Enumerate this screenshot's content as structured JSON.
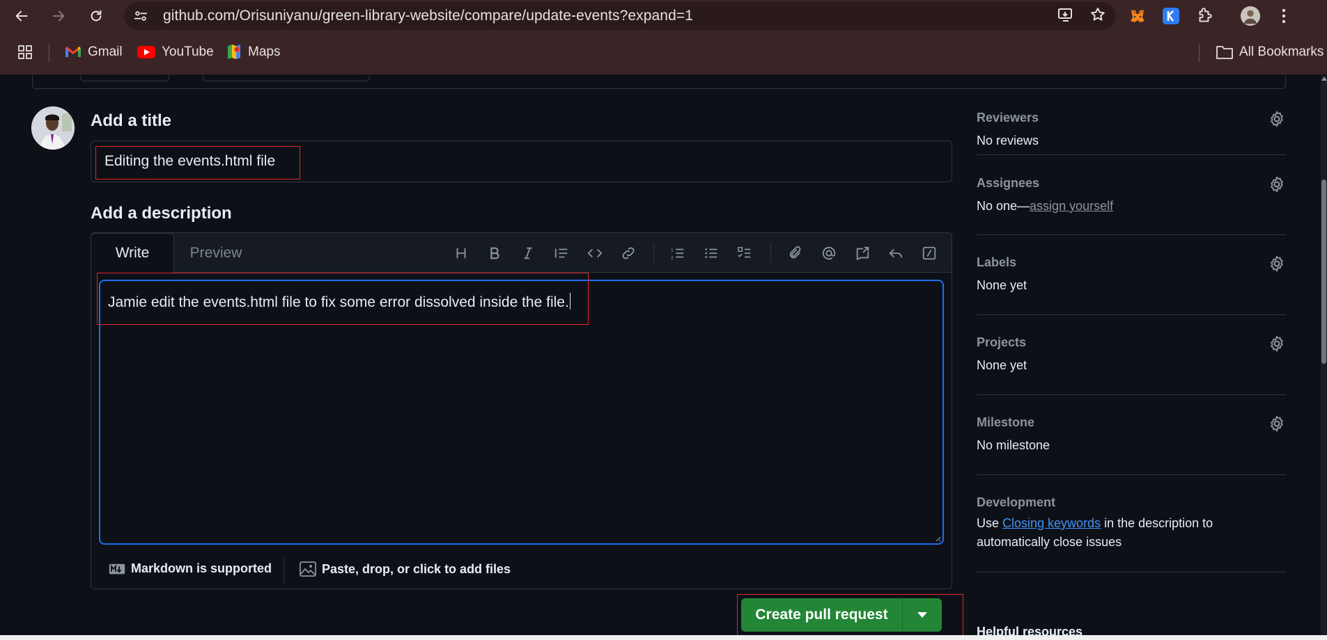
{
  "browser": {
    "url": "github.com/Orisuniyanu/green-library-website/compare/update-events?expand=1",
    "bookmarks": [
      {
        "label": "Gmail",
        "icon": "gmail-icon"
      },
      {
        "label": "YouTube",
        "icon": "youtube-icon"
      },
      {
        "label": "Maps",
        "icon": "maps-icon"
      }
    ],
    "all_bookmarks_label": "All Bookmarks"
  },
  "pr_form": {
    "title_heading": "Add a title",
    "title_value": "Editing the events.html file",
    "description_heading": "Add a description",
    "tabs": [
      "Write",
      "Preview"
    ],
    "description_value": "Jamie edit the events.html file to fix some error dissolved inside the file.",
    "markdown_note": "Markdown is supported",
    "attach_note": "Paste, drop, or click to add files",
    "submit_label": "Create pull request"
  },
  "sidebar": {
    "reviewers": {
      "heading": "Reviewers",
      "value": "No reviews"
    },
    "assignees": {
      "heading": "Assignees",
      "value_prefix": "No one—",
      "value_link": "assign yourself"
    },
    "labels": {
      "heading": "Labels",
      "value": "None yet"
    },
    "projects": {
      "heading": "Projects",
      "value": "None yet"
    },
    "milestone": {
      "heading": "Milestone",
      "value": "No milestone"
    },
    "development": {
      "heading": "Development",
      "text_prefix": "Use ",
      "link": "Closing keywords",
      "text_suffix": " in the description to automatically close issues"
    },
    "helpful": {
      "heading": "Helpful resources"
    }
  },
  "colors": {
    "chrome_bg": "#3b2426",
    "page_bg": "#0d1117",
    "border": "#30363d",
    "focus_blue": "#1f6feb",
    "primary_green": "#238636",
    "annotation_red": "#e0262b",
    "link_blue": "#4493f8"
  }
}
